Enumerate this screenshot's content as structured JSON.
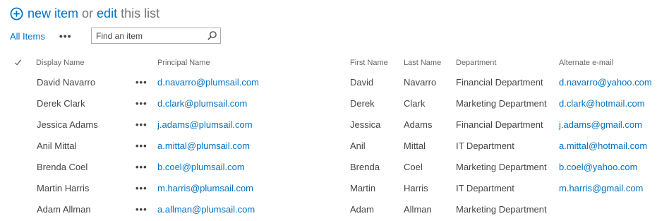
{
  "header": {
    "new_item": "new item",
    "or": "or",
    "edit": "edit",
    "this_list": "this list"
  },
  "toolbar": {
    "all_items": "All Items",
    "more": "•••",
    "search_placeholder": "Find an item"
  },
  "columns": {
    "display_name": "Display Name",
    "principal_name": "Principal Name",
    "first_name": "First Name",
    "last_name": "Last Name",
    "department": "Department",
    "alternate_email": "Alternate e-mail"
  },
  "row_menu": "•••",
  "rows": [
    {
      "display_name": "David Navarro",
      "principal_name": "d.navarro@plumsail.com",
      "first_name": "David",
      "last_name": "Navarro",
      "department": "Financial Department",
      "alternate_email": "d.navarro@yahoo.com"
    },
    {
      "display_name": "Derek Clark",
      "principal_name": "d.clark@plumsail.com",
      "first_name": "Derek",
      "last_name": "Clark",
      "department": "Marketing Department",
      "alternate_email": "d.clark@hotmail.com"
    },
    {
      "display_name": "Jessica Adams",
      "principal_name": "j.adams@plumsail.com",
      "first_name": "Jessica",
      "last_name": "Adams",
      "department": "Financial Department",
      "alternate_email": "j.adams@gmail.com"
    },
    {
      "display_name": "Anil Mittal",
      "principal_name": "a.mittal@plumsail.com",
      "first_name": "Anil",
      "last_name": "Mittal",
      "department": "IT Department",
      "alternate_email": "a.mittal@hotmail.com"
    },
    {
      "display_name": "Brenda Coel",
      "principal_name": "b.coel@plumsail.com",
      "first_name": "Brenda",
      "last_name": "Coel",
      "department": "Marketing Department",
      "alternate_email": "b.coel@yahoo.com"
    },
    {
      "display_name": "Martin Harris",
      "principal_name": "m.harris@plumsail.com",
      "first_name": "Martin",
      "last_name": "Harris",
      "department": "IT Department",
      "alternate_email": "m.harris@gmail.com"
    },
    {
      "display_name": "Adam Allman",
      "principal_name": "a.allman@plumsail.com",
      "first_name": "Adam",
      "last_name": "Allman",
      "department": "Marketing Department",
      "alternate_email": ""
    }
  ],
  "colors": {
    "link": "#0072c6",
    "text": "#444444",
    "muted": "#777777"
  }
}
